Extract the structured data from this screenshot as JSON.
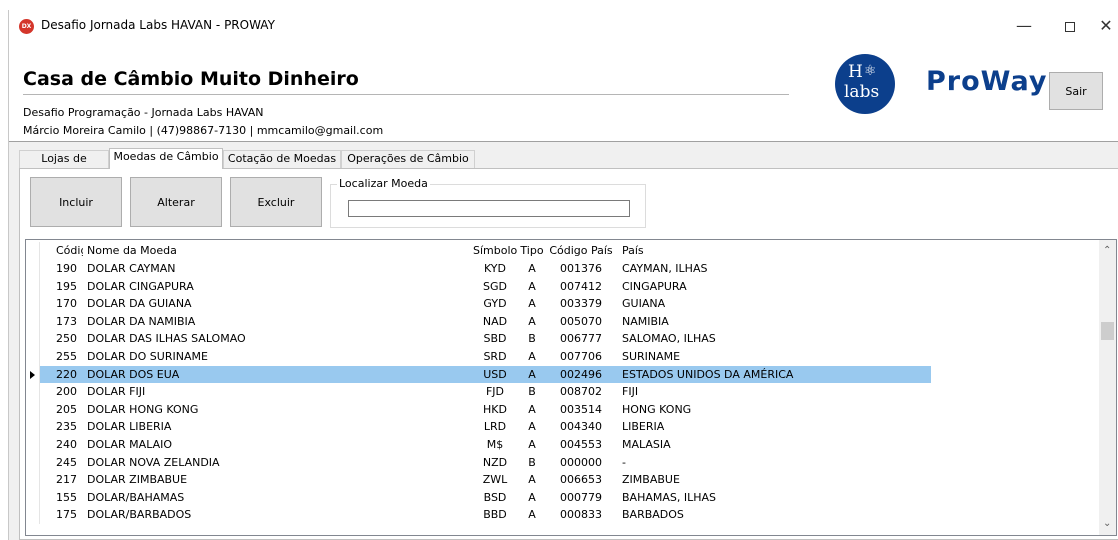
{
  "window": {
    "title": "Desafio Jornada Labs HAVAN - PROWAY",
    "icon_text": "DX",
    "min_glyph": "—",
    "close_glyph": "✕"
  },
  "header": {
    "title": "Casa de Câmbio Muito Dinheiro",
    "subtitle": "Desafio Programação - Jornada Labs HAVAN",
    "contact": "Márcio Moreira Camilo | (47)98867-7130 | mmcamilo@gmail.com",
    "logo_h": "H",
    "logo_labs": "labs",
    "brand": "ProWay",
    "exit_label": "Sair"
  },
  "tabs": [
    {
      "label": "Lojas de Câmbio"
    },
    {
      "label": "Moedas de Câmbio"
    },
    {
      "label": "Cotação de Moedas"
    },
    {
      "label": "Operações de Câmbio"
    }
  ],
  "toolbar": {
    "include_label": "Incluir",
    "edit_label": "Alterar",
    "delete_label": "Excluir",
    "search_legend": "Localizar Moeda",
    "search_value": ""
  },
  "grid": {
    "columns": [
      "Código",
      "Nome da Moeda",
      "Símbolo",
      "Tipo",
      "Código País",
      "País"
    ],
    "rows": [
      {
        "codigo": "190",
        "nome": "DOLAR CAYMAN",
        "simbolo": "KYD",
        "tipo": "A",
        "cod_pais": "001376",
        "pais": "CAYMAN, ILHAS"
      },
      {
        "codigo": "195",
        "nome": "DOLAR CINGAPURA",
        "simbolo": "SGD",
        "tipo": "A",
        "cod_pais": "007412",
        "pais": "CINGAPURA"
      },
      {
        "codigo": "170",
        "nome": "DOLAR DA GUIANA",
        "simbolo": "GYD",
        "tipo": "A",
        "cod_pais": "003379",
        "pais": "GUIANA"
      },
      {
        "codigo": "173",
        "nome": "DOLAR DA NAMIBIA",
        "simbolo": "NAD",
        "tipo": "A",
        "cod_pais": "005070",
        "pais": "NAMIBIA"
      },
      {
        "codigo": "250",
        "nome": "DOLAR DAS ILHAS SALOMAO",
        "simbolo": "SBD",
        "tipo": "B",
        "cod_pais": "006777",
        "pais": "SALOMAO, ILHAS"
      },
      {
        "codigo": "255",
        "nome": "DOLAR DO SURINAME",
        "simbolo": "SRD",
        "tipo": "A",
        "cod_pais": "007706",
        "pais": "SURINAME"
      },
      {
        "codigo": "220",
        "nome": "DOLAR DOS EUA",
        "simbolo": "USD",
        "tipo": "A",
        "cod_pais": "002496",
        "pais": "ESTADOS UNIDOS DA AMÉRICA"
      },
      {
        "codigo": "200",
        "nome": "DOLAR FIJI",
        "simbolo": "FJD",
        "tipo": "B",
        "cod_pais": "008702",
        "pais": "FIJI"
      },
      {
        "codigo": "205",
        "nome": "DOLAR HONG KONG",
        "simbolo": "HKD",
        "tipo": "A",
        "cod_pais": "003514",
        "pais": "HONG KONG"
      },
      {
        "codigo": "235",
        "nome": "DOLAR LIBERIA",
        "simbolo": "LRD",
        "tipo": "A",
        "cod_pais": "004340",
        "pais": "LIBERIA"
      },
      {
        "codigo": "240",
        "nome": "DOLAR MALAIO",
        "simbolo": "M$",
        "tipo": "A",
        "cod_pais": "004553",
        "pais": "MALASIA"
      },
      {
        "codigo": "245",
        "nome": "DOLAR NOVA ZELANDIA",
        "simbolo": "NZD",
        "tipo": "B",
        "cod_pais": "000000",
        "pais": "-"
      },
      {
        "codigo": "217",
        "nome": "DOLAR ZIMBABUE",
        "simbolo": "ZWL",
        "tipo": "A",
        "cod_pais": "006653",
        "pais": "ZIMBABUE"
      },
      {
        "codigo": "155",
        "nome": "DOLAR/BAHAMAS",
        "simbolo": "BSD",
        "tipo": "A",
        "cod_pais": "000779",
        "pais": "BAHAMAS, ILHAS"
      },
      {
        "codigo": "175",
        "nome": "DOLAR/BARBADOS",
        "simbolo": "BBD",
        "tipo": "A",
        "cod_pais": "000833",
        "pais": "BARBADOS"
      }
    ],
    "selected_index": 6,
    "scroll_up_glyph": "⌃",
    "scroll_down_glyph": "⌄"
  },
  "colors": {
    "selection": "#99c9ef",
    "brand_blue": "#0c3f8c",
    "button_face": "#e1e1e1"
  }
}
